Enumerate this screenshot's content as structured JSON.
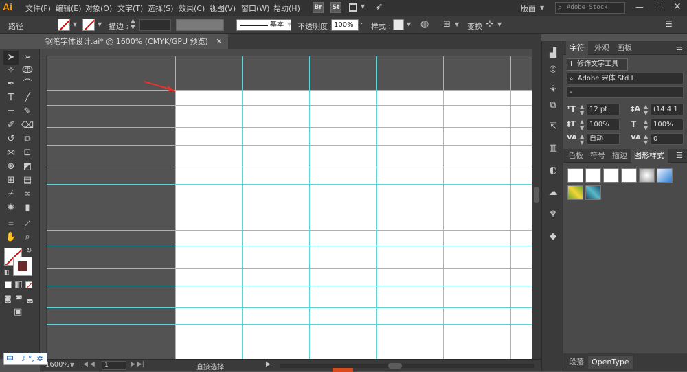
{
  "app": {
    "logo": "Ai"
  },
  "menu": [
    "文件(F)",
    "编辑(E)",
    "对象(O)",
    "文字(T)",
    "选择(S)",
    "效果(C)",
    "视图(V)",
    "窗口(W)",
    "帮助(H)"
  ],
  "topbar": {
    "bridge": "Br",
    "stock": "St",
    "workspace": "版面",
    "search_placeholder": "Adobe Stock"
  },
  "control": {
    "selection_label": "路径",
    "stroke_label": "描边 :",
    "stroke_style": "基本",
    "opacity_label": "不透明度 :",
    "opacity_value": "100%",
    "style_label": "样式 :",
    "transform_label": "变换"
  },
  "document": {
    "tab_title": "钢笔字体设计.ai* @ 1600% (CMYK/GPU 预览)"
  },
  "status": {
    "zoom": "1600%",
    "page": "1",
    "tool": "直接选择"
  },
  "ime": {
    "label": "中",
    "extra": "☽ °, ✲"
  },
  "char_panel": {
    "tabs": [
      "字符",
      "外观",
      "画板"
    ],
    "touch_type": "修饰文字工具",
    "font_family": "Adobe 宋体 Std L",
    "font_style": "-",
    "font_size": "12 pt",
    "leading": "(14.4 1",
    "vscale": "100%",
    "hscale": "100%",
    "kerning": "自动",
    "tracking": "0"
  },
  "style_panel": {
    "tabs": [
      "色板",
      "符号",
      "描边",
      "图形样式"
    ]
  },
  "bottom_tabs": [
    "段落",
    "OpenType"
  ],
  "colors": {
    "guide": "#5fd3d8",
    "accent": "#ff9a00",
    "arrow": "#e8322e"
  }
}
